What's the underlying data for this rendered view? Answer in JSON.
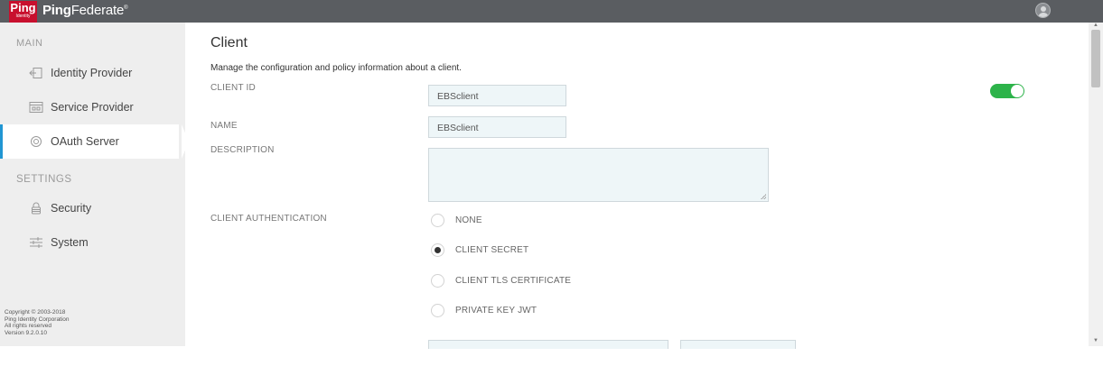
{
  "header": {
    "logo_text": "Ping",
    "logo_subtext": "Identity",
    "product_name_bold": "Ping",
    "product_name_light": "Federate",
    "trademark": "®"
  },
  "sidebar": {
    "main_heading": "MAIN",
    "settings_heading": "SETTINGS",
    "items": [
      {
        "label": "Identity Provider",
        "icon": "identity-provider-icon"
      },
      {
        "label": "Service Provider",
        "icon": "service-provider-icon"
      },
      {
        "label": "OAuth Server",
        "icon": "oauth-server-icon",
        "active": true
      },
      {
        "label": "Security",
        "icon": "lock-icon"
      },
      {
        "label": "System",
        "icon": "system-sliders-icon"
      }
    ],
    "copyright": [
      "Copyright © 2003-2018",
      "Ping Identity Corporation",
      "All rights reserved",
      "Version 9.2.0.10"
    ]
  },
  "main": {
    "title": "Client",
    "description": "Manage the configuration and policy information about a client.",
    "client_id_label": "CLIENT ID",
    "client_id_value": "EBSclient",
    "name_label": "NAME",
    "name_value": "EBSclient",
    "description_label": "DESCRIPTION",
    "description_value": "",
    "client_auth_label": "CLIENT AUTHENTICATION",
    "client_auth_options": [
      {
        "label": "NONE",
        "checked": false
      },
      {
        "label": "CLIENT SECRET",
        "checked": true
      },
      {
        "label": "CLIENT TLS CERTIFICATE",
        "checked": false
      },
      {
        "label": "PRIVATE KEY JWT",
        "checked": false
      }
    ],
    "enabled_toggle": true
  },
  "colors": {
    "topbar": "#5a5d61",
    "brand_red": "#c8102e",
    "active_accent": "#2196d3",
    "toggle_on": "#2db34a",
    "input_bg": "#eef6f8"
  }
}
